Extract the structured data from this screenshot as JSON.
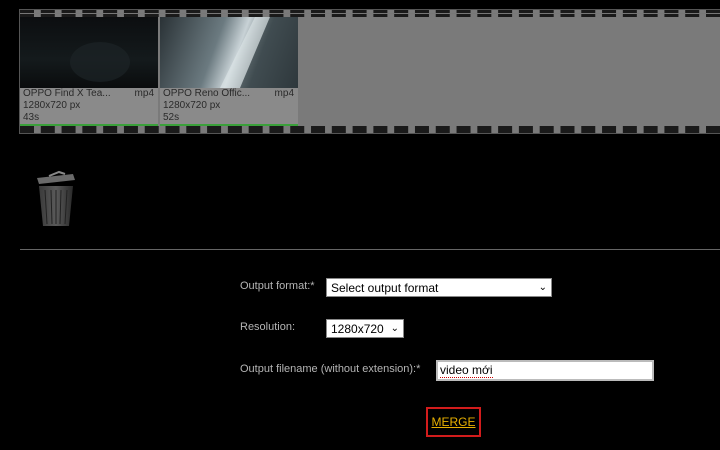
{
  "clips": [
    {
      "name": "OPPO Find X Tea...",
      "ext": "mp4",
      "resolution": "1280x720 px",
      "duration": "43s",
      "progress": 1.0
    },
    {
      "name": "OPPO Reno Offic...",
      "ext": "mp4",
      "resolution": "1280x720 px",
      "duration": "52s",
      "progress": 1.0
    }
  ],
  "form": {
    "output_format_label": "Output format:*",
    "output_format_value": "Select output format",
    "resolution_label": "Resolution:",
    "resolution_value": "1280x720",
    "filename_label": "Output filename (without extension):*",
    "filename_value": "video mới",
    "merge_label": "MERGE"
  },
  "colors": {
    "accent": "#e8b000",
    "highlight_border": "#d21c1c",
    "progress": "#3aa03a"
  },
  "icons": [
    "trash-icon",
    "chevron-down-icon"
  ]
}
